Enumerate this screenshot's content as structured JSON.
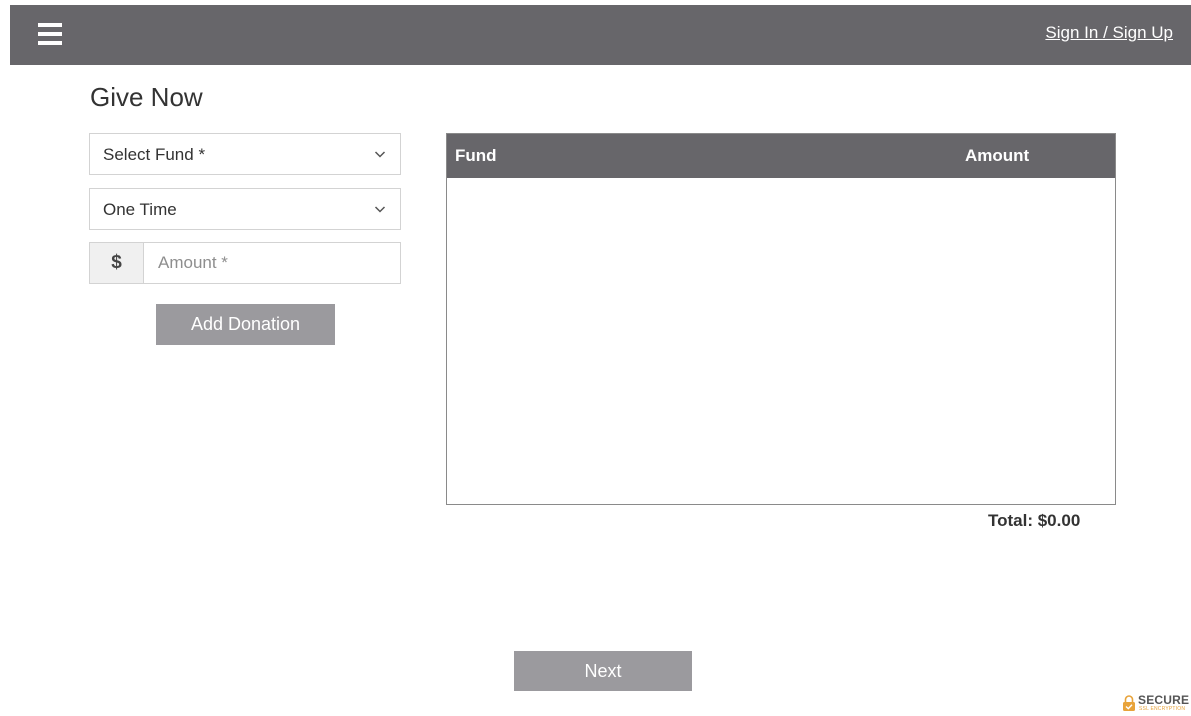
{
  "header": {
    "menu_icon": "hamburger-menu-icon",
    "signin_label": "Sign In / Sign Up"
  },
  "page": {
    "title": "Give Now"
  },
  "form": {
    "fund_select": {
      "value": "Select Fund *",
      "icon": "chevron-down-icon"
    },
    "frequency_select": {
      "value": "One Time",
      "icon": "chevron-down-icon"
    },
    "amount": {
      "currency_symbol": "$",
      "placeholder": "Amount *",
      "value": ""
    },
    "add_button_label": "Add Donation"
  },
  "donation_table": {
    "columns": [
      "Fund",
      "Amount"
    ],
    "rows": [],
    "total_text": "Total: $0.00"
  },
  "footer": {
    "next_button_label": "Next",
    "secure_badge": {
      "label": "SECURE",
      "sublabel": "SSL ENCRYPTION",
      "icon": "lock-icon"
    }
  },
  "colors": {
    "header_bg": "#67666a",
    "button_bg": "#9b9a9e",
    "badge_accent": "#e8a33a"
  }
}
